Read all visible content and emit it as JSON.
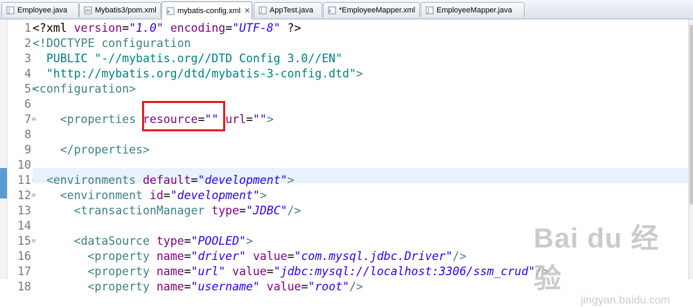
{
  "tabs": [
    {
      "label": "Employee.java",
      "icon": "java-file-icon",
      "active": false
    },
    {
      "label": "Mybatis3/pom.xml",
      "icon": "maven-pom-icon",
      "active": false
    },
    {
      "label": "mybatis-config.xml",
      "icon": "xml-file-icon",
      "active": true,
      "close": "✕"
    },
    {
      "label": "AppTest.java",
      "icon": "java-file-icon",
      "active": false
    },
    {
      "label": "*EmployeeMapper.xml",
      "icon": "xml-file-icon",
      "active": false
    },
    {
      "label": "EmployeeMapper.java",
      "icon": "java-file-icon",
      "active": false
    }
  ],
  "lines": [
    {
      "n": "1",
      "fold": "",
      "tokens": [
        [
          "plain",
          "<?xml "
        ],
        [
          "attr",
          "version"
        ],
        [
          "plain",
          "="
        ],
        [
          "str",
          "\"1.0\""
        ],
        [
          "plain",
          " "
        ],
        [
          "attr",
          "encoding"
        ],
        [
          "plain",
          "="
        ],
        [
          "str",
          "\"UTF-8\""
        ],
        [
          "plain",
          " ?>"
        ]
      ]
    },
    {
      "n": "2",
      "fold": "",
      "tokens": [
        [
          "tag",
          "<!DOCTYPE "
        ],
        [
          "tag",
          "configuration"
        ]
      ]
    },
    {
      "n": "3",
      "fold": "",
      "tokens": [
        [
          "doct",
          "  PUBLIC "
        ],
        [
          "doct",
          "\"-//mybatis.org//DTD Config 3.0//EN\""
        ]
      ]
    },
    {
      "n": "4",
      "fold": "",
      "tokens": [
        [
          "doct",
          "  \"http://mybatis.org/dtd/mybatis-3-config.dtd\""
        ],
        [
          "tag",
          ">"
        ]
      ]
    },
    {
      "n": "5",
      "fold": "⊖",
      "tokens": [
        [
          "tag",
          "<configuration>"
        ]
      ]
    },
    {
      "n": "6",
      "fold": "",
      "tokens": []
    },
    {
      "n": "7",
      "fold": "⊖",
      "tokens": [
        [
          "plain",
          "    "
        ],
        [
          "tag",
          "<properties"
        ],
        [
          "plain",
          " "
        ],
        [
          "attr",
          "resource"
        ],
        [
          "plain",
          "="
        ],
        [
          "str",
          "\"\""
        ],
        [
          "plain",
          " "
        ],
        [
          "attr",
          "url"
        ],
        [
          "plain",
          "="
        ],
        [
          "str",
          "\"\""
        ],
        [
          "tag",
          ">"
        ]
      ]
    },
    {
      "n": "8",
      "fold": "",
      "tokens": []
    },
    {
      "n": "9",
      "fold": "",
      "tokens": [
        [
          "plain",
          "    "
        ],
        [
          "tag",
          "</properties>"
        ]
      ]
    },
    {
      "n": "10",
      "fold": "",
      "tokens": []
    },
    {
      "n": "11",
      "fold": "⊖",
      "tokens": [
        [
          "plain",
          "  "
        ],
        [
          "tag",
          "<environments"
        ],
        [
          "plain",
          " "
        ],
        [
          "attr",
          "default"
        ],
        [
          "plain",
          "="
        ],
        [
          "str",
          "\"development\""
        ],
        [
          "tag",
          ">"
        ]
      ]
    },
    {
      "n": "12",
      "fold": "⊖",
      "tokens": [
        [
          "plain",
          "    "
        ],
        [
          "tag",
          "<environment"
        ],
        [
          "plain",
          " "
        ],
        [
          "attr",
          "id"
        ],
        [
          "plain",
          "="
        ],
        [
          "str",
          "\"development\""
        ],
        [
          "tag",
          ">"
        ]
      ]
    },
    {
      "n": "13",
      "fold": "",
      "tokens": [
        [
          "plain",
          "      "
        ],
        [
          "tag",
          "<transactionManager"
        ],
        [
          "plain",
          " "
        ],
        [
          "attr",
          "type"
        ],
        [
          "plain",
          "="
        ],
        [
          "str",
          "\"JDBC\""
        ],
        [
          "tag",
          "/>"
        ]
      ]
    },
    {
      "n": "14",
      "fold": "",
      "tokens": []
    },
    {
      "n": "15",
      "fold": "⊖",
      "tokens": [
        [
          "plain",
          "      "
        ],
        [
          "tag",
          "<dataSource"
        ],
        [
          "plain",
          " "
        ],
        [
          "attr",
          "type"
        ],
        [
          "plain",
          "="
        ],
        [
          "str",
          "\"POOLED\""
        ],
        [
          "tag",
          ">"
        ]
      ]
    },
    {
      "n": "16",
      "fold": "",
      "tokens": [
        [
          "plain",
          "        "
        ],
        [
          "tag",
          "<property"
        ],
        [
          "plain",
          " "
        ],
        [
          "attr",
          "name"
        ],
        [
          "plain",
          "="
        ],
        [
          "str",
          "\"driver\""
        ],
        [
          "plain",
          " "
        ],
        [
          "attr",
          "value"
        ],
        [
          "plain",
          "="
        ],
        [
          "str",
          "\"com.mysql.jdbc.Driver\""
        ],
        [
          "tag",
          "/>"
        ]
      ]
    },
    {
      "n": "17",
      "fold": "",
      "tokens": [
        [
          "plain",
          "        "
        ],
        [
          "tag",
          "<property"
        ],
        [
          "plain",
          " "
        ],
        [
          "attr",
          "name"
        ],
        [
          "plain",
          "="
        ],
        [
          "str",
          "\"url\""
        ],
        [
          "plain",
          " "
        ],
        [
          "attr",
          "value"
        ],
        [
          "plain",
          "="
        ],
        [
          "str",
          "\"jdbc:mysql://localhost:3306/ssm_crud\""
        ],
        [
          "tag",
          "/>"
        ]
      ]
    },
    {
      "n": "18",
      "fold": "",
      "tokens": [
        [
          "plain",
          "        "
        ],
        [
          "tag",
          "<property"
        ],
        [
          "plain",
          " "
        ],
        [
          "attr",
          "name"
        ],
        [
          "plain",
          "="
        ],
        [
          "str",
          "\"username\""
        ],
        [
          "plain",
          " "
        ],
        [
          "attr",
          "value"
        ],
        [
          "plain",
          "="
        ],
        [
          "str",
          "\"root\""
        ],
        [
          "tag",
          "/>"
        ]
      ]
    }
  ],
  "watermark": {
    "main": "Bai du 经验",
    "sub": "jingyan.baidu.com"
  }
}
